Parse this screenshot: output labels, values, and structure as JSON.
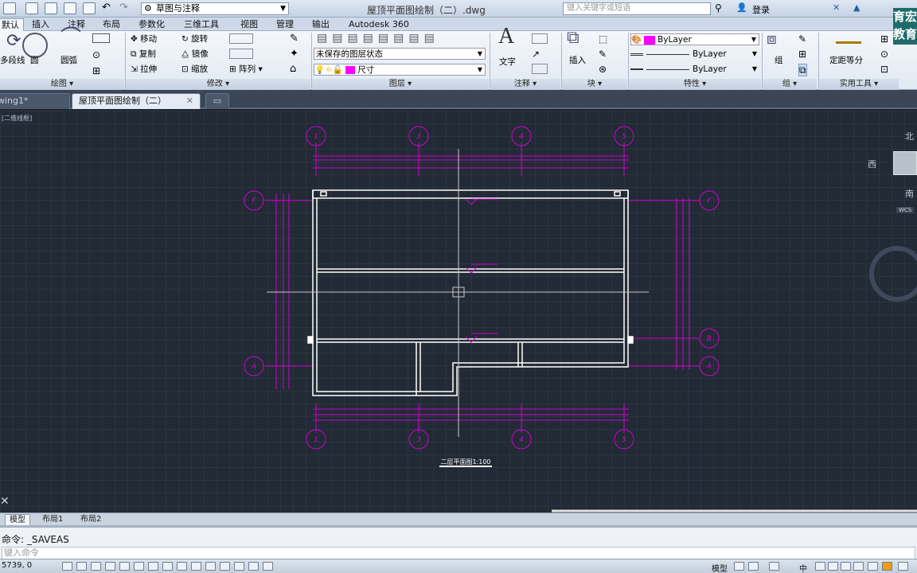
{
  "titlebar": {
    "workspace": "草图与注释",
    "title": "屋顶平面图绘制（二）.dwg",
    "search_placeholder": "键入关键字或短语",
    "login": "登录",
    "quick_access_icons": [
      "new-icon",
      "open-icon",
      "save-icon",
      "saveas-icon",
      "print-icon",
      "undo-icon",
      "redo-icon"
    ]
  },
  "menu": {
    "tabs": [
      "默认",
      "插入",
      "注释",
      "布局",
      "参数化",
      "三维工具",
      "视图",
      "管理",
      "输出",
      "Autodesk 360"
    ],
    "active": 0
  },
  "ribbon": {
    "draw": {
      "title": "绘图 ▾",
      "polyline": "多段线",
      "circle": "圆",
      "arc": "圆弧"
    },
    "modify": {
      "title": "修改 ▾",
      "move": "移动",
      "rotate": "旋转",
      "copy": "复制",
      "mirror": "镜像",
      "stretch": "拉伸",
      "scale": "缩放",
      "array": "阵列"
    },
    "layers": {
      "title": "图层 ▾",
      "state": "未保存的图层状态",
      "current_layer": "尺寸",
      "current_layer_color": "#ff00ff"
    },
    "annotation": {
      "title": "注释 ▾",
      "text": "文字"
    },
    "block": {
      "title": "块 ▾",
      "insert": "插入"
    },
    "properties": {
      "title": "特性 ▾",
      "color": "ByLayer",
      "linetype": "ByLayer",
      "lineweight": "ByLayer"
    },
    "groups": {
      "title": "组 ▾",
      "group": "组"
    },
    "utilities": {
      "title": "实用工具 ▾",
      "measure": "定距等分"
    }
  },
  "doc_tabs": [
    "wing1*",
    "屋顶平面图绘制（二）"
  ],
  "canvas": {
    "viewport_label": "[二维线框]",
    "compass": {
      "north": "北",
      "south": "南",
      "west": "西",
      "wcs": "WCS"
    },
    "drawing_title": "二层平面图1:100",
    "axis_labels_top": [
      "1",
      "3",
      "4",
      "5"
    ],
    "axis_labels_bottom": [
      "1",
      "3",
      "4",
      "5"
    ],
    "axis_labels_left": [
      "F",
      "A"
    ],
    "axis_labels_right": [
      "F",
      "B",
      "A"
    ],
    "colors": {
      "dimension": "#d000d0",
      "wall": "#ffffff",
      "crosshair": "#c8c8c8"
    }
  },
  "layout_tabs": [
    "模型",
    "布局1",
    "布局2"
  ],
  "command": {
    "last": "命令: _SAVEAS",
    "prompt": "键入命令"
  },
  "status": {
    "coords": "5739, 0",
    "model": "模型",
    "ime": "中"
  },
  "watermark": "育宏教育"
}
